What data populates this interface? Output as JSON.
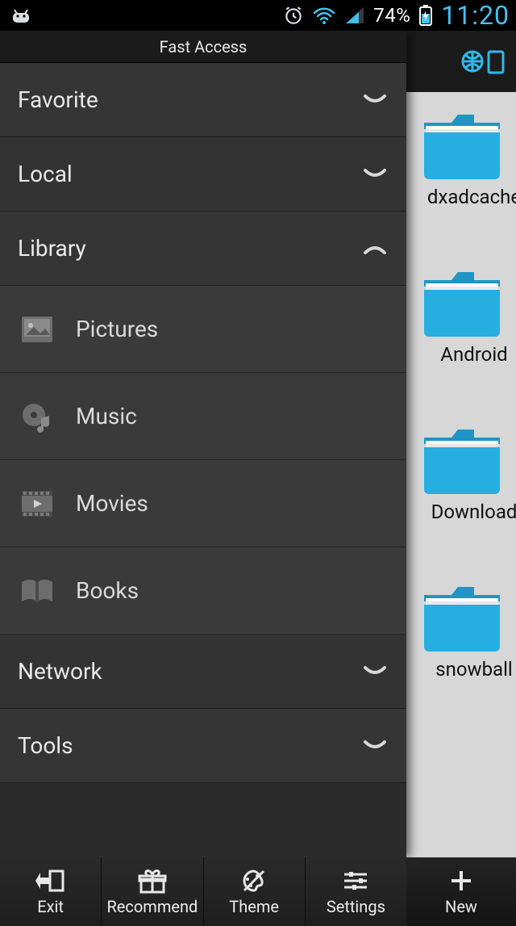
{
  "statusbar": {
    "battery_pct": "74%",
    "clock": "11:20"
  },
  "drawer": {
    "title": "Fast Access",
    "sections": {
      "favorite": {
        "label": "Favorite",
        "expanded": false
      },
      "local": {
        "label": "Local",
        "expanded": false
      },
      "library": {
        "label": "Library",
        "expanded": true
      },
      "network": {
        "label": "Network",
        "expanded": false
      },
      "tools": {
        "label": "Tools",
        "expanded": false
      }
    },
    "library_items": {
      "pictures": {
        "label": "Pictures"
      },
      "music": {
        "label": "Music"
      },
      "movies": {
        "label": "Movies"
      },
      "books": {
        "label": "Books"
      }
    }
  },
  "content": {
    "folders": [
      {
        "label": "dxadcache"
      },
      {
        "label": "Android"
      },
      {
        "label": "Download"
      },
      {
        "label": "snowball"
      }
    ]
  },
  "bottombar": {
    "exit": {
      "label": "Exit"
    },
    "recommend": {
      "label": "Recommend"
    },
    "theme": {
      "label": "Theme"
    },
    "settings": {
      "label": "Settings"
    },
    "new": {
      "label": "New"
    }
  },
  "colors": {
    "accent": "#3fc3f0",
    "folder": "#27aee0"
  }
}
